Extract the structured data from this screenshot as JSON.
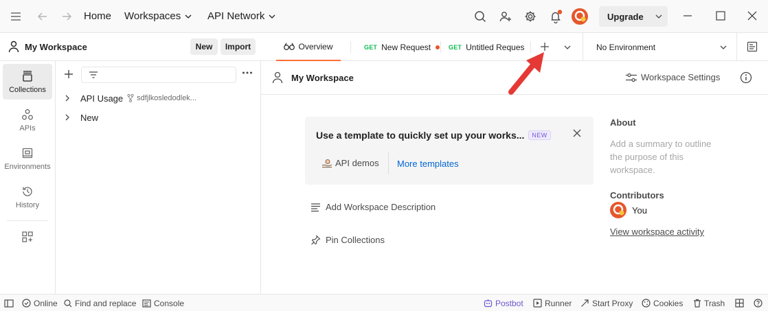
{
  "titlebar": {
    "nav": {
      "home": "Home",
      "workspaces": "Workspaces",
      "api_network": "API Network"
    },
    "upgrade_label": "Upgrade"
  },
  "sidebar": {
    "workspace_name": "My Workspace",
    "new_label": "New",
    "import_label": "Import",
    "rail": [
      {
        "label": "Collections",
        "icon": "collections-icon"
      },
      {
        "label": "APIs",
        "icon": "apis-icon"
      },
      {
        "label": "Environments",
        "icon": "environments-icon"
      },
      {
        "label": "History",
        "icon": "history-icon"
      }
    ],
    "tree": [
      {
        "label": "API Usage",
        "fork": "sdfjlkosledodlek..."
      },
      {
        "label": "New"
      }
    ]
  },
  "tabs": {
    "overview": "Overview",
    "items": [
      {
        "method": "GET",
        "label": "New Request"
      },
      {
        "method": "GET",
        "label": "Untitled Request"
      }
    ],
    "environment": "No Environment"
  },
  "workspace": {
    "title": "My Workspace",
    "settings_label": "Workspace Settings",
    "template_card": {
      "title": "Use a template to quickly set up your works...",
      "badge": "NEW",
      "api_demos": "API demos",
      "more_templates": "More templates"
    },
    "add_description": "Add Workspace Description",
    "pin_collections": "Pin Collections"
  },
  "about": {
    "heading": "About",
    "summary": "Add a summary to outline the purpose of this workspace.",
    "contributors_heading": "Contributors",
    "contributor": "You",
    "activity_link": "View workspace activity"
  },
  "statusbar": {
    "online": "Online",
    "find_replace": "Find and replace",
    "console": "Console",
    "postbot": "Postbot",
    "runner": "Runner",
    "start_proxy": "Start Proxy",
    "cookies": "Cookies",
    "trash": "Trash"
  },
  "colors": {
    "accent": "#ff6c37",
    "link": "#0265d2",
    "get": "#0cbb52",
    "arrow": "#e53935"
  }
}
